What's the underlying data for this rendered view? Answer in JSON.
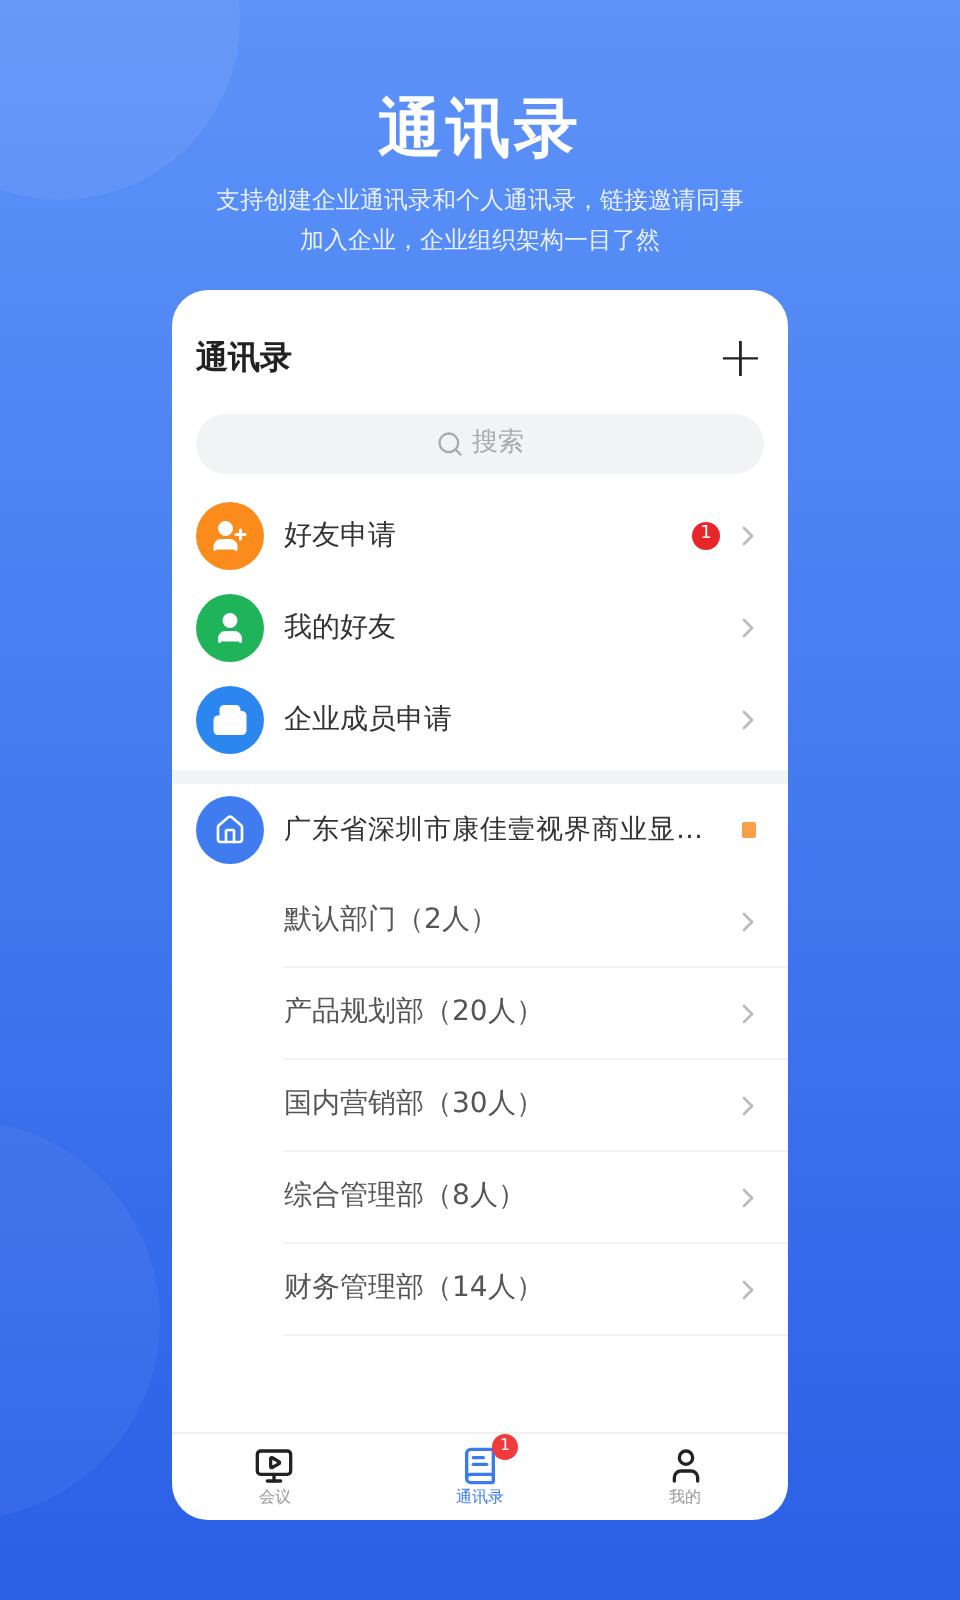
{
  "header": {
    "title": "通讯录",
    "subtitle_lines": [
      "支持创建企业通讯录和个人通讯录，链接邀请同事",
      "加入企业，企业组织架构一目了然"
    ]
  },
  "card": {
    "title": "通讯录",
    "add_label": "+",
    "search": {
      "placeholder": "搜索"
    },
    "quick_items": [
      {
        "kind": "add-friend",
        "label": "好友申请",
        "color": "#fb8c1c",
        "badge": "1"
      },
      {
        "kind": "friends",
        "label": "我的好友",
        "color": "#1fb35a"
      },
      {
        "kind": "company",
        "label": "企业成员申请",
        "color": "#2b86f0"
      }
    ],
    "company": {
      "name": "广东省深圳市康佳壹视界商业显…"
    },
    "departments": [
      "默认部门（2人）",
      "产品规划部（20人）",
      "国内营销部（30人）",
      "综合管理部（8人）",
      "财务管理部（14人）"
    ]
  },
  "tabs": [
    {
      "kind": "meeting",
      "label": "会议",
      "selected": false
    },
    {
      "kind": "contacts",
      "label": "通讯录",
      "selected": true,
      "badge": "1"
    },
    {
      "kind": "me",
      "label": "我的",
      "selected": false
    }
  ]
}
